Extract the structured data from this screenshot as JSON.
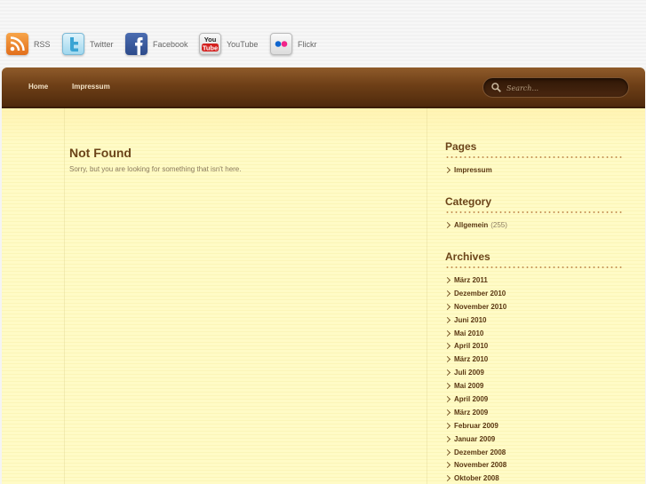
{
  "social": [
    {
      "label": "RSS",
      "icon": "rss-icon"
    },
    {
      "label": "Twitter",
      "icon": "twitter-icon"
    },
    {
      "label": "Facebook",
      "icon": "facebook-icon"
    },
    {
      "label": "YouTube",
      "icon": "youtube-icon"
    },
    {
      "label": "Flickr",
      "icon": "flickr-icon"
    }
  ],
  "nav": {
    "home": "Home",
    "impressum": "Impressum"
  },
  "search": {
    "placeholder": "Search..."
  },
  "post": {
    "title": "Not Found",
    "text": "Sorry, but you are looking for something that isn't here."
  },
  "sidebar": {
    "pages": {
      "title": "Pages",
      "items": [
        "Impressum"
      ]
    },
    "category": {
      "title": "Category",
      "items": [
        {
          "label": "Allgemein",
          "count": "(255)"
        }
      ]
    },
    "archives": {
      "title": "Archives",
      "items": [
        "März 2011",
        "Dezember 2010",
        "November 2010",
        "Juni 2010",
        "Mai 2010",
        "April 2010",
        "März 2010",
        "Juli 2009",
        "Mai 2009",
        "April 2009",
        "März 2009",
        "Februar 2009",
        "Januar 2009",
        "Dezember 2008",
        "November 2008",
        "Oktober 2008"
      ]
    }
  },
  "colors": {
    "nav_bg": "#6e3f17",
    "content_bg": "#fffbc8",
    "heading": "#6b4419",
    "link": "#5a3712"
  }
}
